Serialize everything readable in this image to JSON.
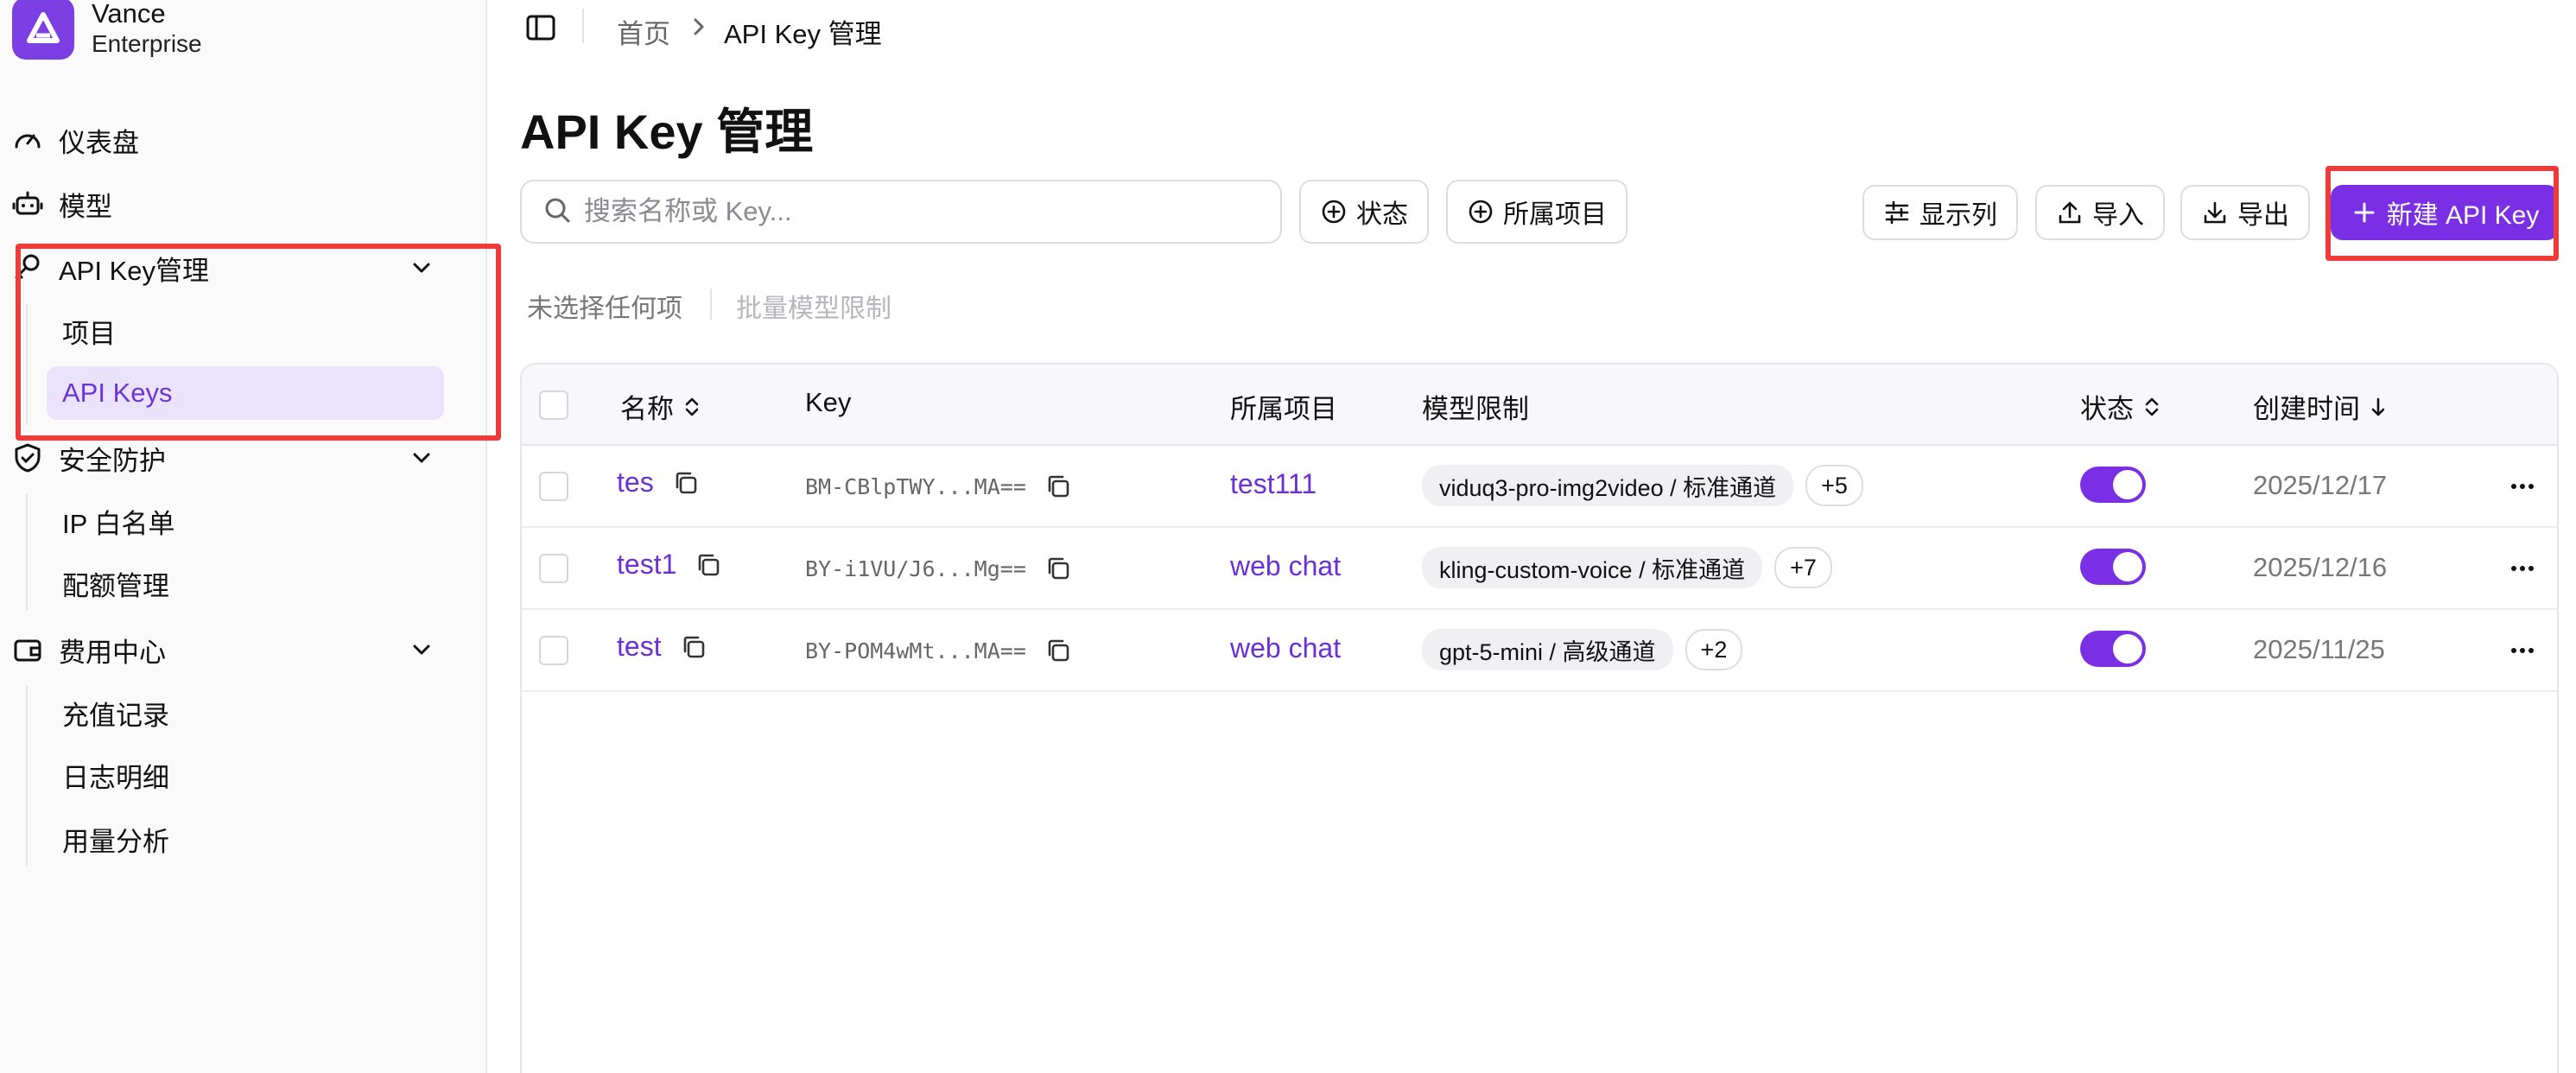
{
  "brand": {
    "name": "Vance",
    "subtitle": "Enterprise",
    "color": "#7b3fe4"
  },
  "sidebar": {
    "items": [
      {
        "label": "仪表盘",
        "icon": "gauge-icon"
      },
      {
        "label": "模型",
        "icon": "bot-icon"
      },
      {
        "label": "API Key管理",
        "icon": "key-icon",
        "expanded": true,
        "children": [
          {
            "label": "项目"
          },
          {
            "label": "API Keys",
            "active": true
          }
        ]
      },
      {
        "label": "安全防护",
        "icon": "shield-icon",
        "expanded": true,
        "children": [
          {
            "label": "IP 白名单"
          },
          {
            "label": "配额管理"
          }
        ]
      },
      {
        "label": "费用中心",
        "icon": "wallet-icon",
        "expanded": true,
        "children": [
          {
            "label": "充值记录"
          },
          {
            "label": "日志明细"
          },
          {
            "label": "用量分析"
          }
        ]
      }
    ]
  },
  "breadcrumb": {
    "home": "首页",
    "current": "API Key 管理"
  },
  "page": {
    "title": "API Key 管理"
  },
  "search": {
    "placeholder": "搜索名称或 Key...",
    "value": ""
  },
  "filters": {
    "status": "状态",
    "project": "所属项目"
  },
  "toolbar": {
    "columns": "显示列",
    "import": "导入",
    "export": "导出",
    "create": "新建 API Key"
  },
  "bulk": {
    "selection": "未选择任何项",
    "model_limit": "批量模型限制"
  },
  "table": {
    "headers": {
      "name": "名称",
      "key": "Key",
      "project": "所属项目",
      "models": "模型限制",
      "status": "状态",
      "created": "创建时间"
    },
    "rows": [
      {
        "name": "tes",
        "key": "BM-CBlpTWY...MA==",
        "project": "test111",
        "model": "viduq3-pro-img2video / 标准通道",
        "more": "+5",
        "enabled": true,
        "created": "2025/12/17"
      },
      {
        "name": "test1",
        "key": "BY-i1VU/J6...Mg==",
        "project": "web chat",
        "model": "kling-custom-voice / 标准通道",
        "more": "+7",
        "enabled": true,
        "created": "2025/12/16"
      },
      {
        "name": "test",
        "key": "BY-POM4wMt...MA==",
        "project": "web chat",
        "model": "gpt-5-mini / 高级通道",
        "more": "+2",
        "enabled": true,
        "created": "2025/11/25"
      }
    ]
  },
  "colors": {
    "accent": "#7b2fe4",
    "highlight": "#ec3b3b"
  }
}
